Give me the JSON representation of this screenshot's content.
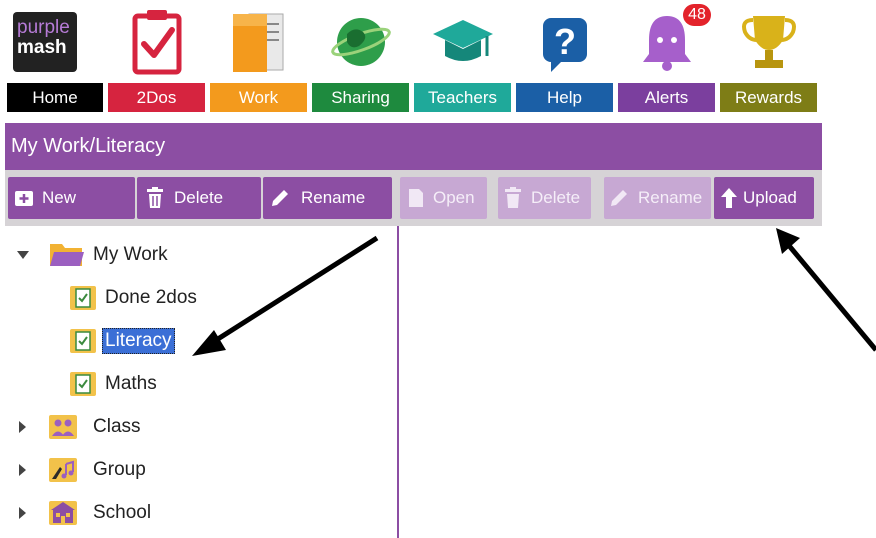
{
  "nav": {
    "items": [
      {
        "key": "home",
        "label": "Home",
        "color": "#000000",
        "icon": "purple-mash-logo",
        "logo_line1": "purple",
        "logo_line2": "mash"
      },
      {
        "key": "2dos",
        "label": "2Dos",
        "color": "#d6243f",
        "icon": "clipboard-check-icon"
      },
      {
        "key": "work",
        "label": "Work",
        "color": "#f39a1d",
        "icon": "folder-icon"
      },
      {
        "key": "sharing",
        "label": "Sharing",
        "color": "#1e8a3e",
        "icon": "globe-icon"
      },
      {
        "key": "teachers",
        "label": "Teachers",
        "color": "#1fa99a",
        "icon": "graduation-cap-icon"
      },
      {
        "key": "help",
        "label": "Help",
        "color": "#1b5fa6",
        "icon": "question-icon"
      },
      {
        "key": "alerts",
        "label": "Alerts",
        "color": "#7b3f9e",
        "icon": "bell-icon",
        "badge": "48"
      },
      {
        "key": "rewards",
        "label": "Rewards",
        "color": "#7e7d16",
        "icon": "trophy-icon"
      }
    ]
  },
  "header": {
    "title": "My Work/Literacy"
  },
  "left_toolbar": {
    "new_label": "New",
    "delete_label": "Delete",
    "rename_label": "Rename"
  },
  "right_toolbar": {
    "open_label": "Open",
    "delete_label": "Delete",
    "rename_label": "Rename",
    "upload_label": "Upload"
  },
  "tree": {
    "my_work": "My Work",
    "done_2dos": "Done 2dos",
    "literacy": "Literacy",
    "maths": "Maths",
    "class": "Class",
    "group": "Group",
    "school": "School"
  },
  "colors": {
    "accent": "#8c4ea3",
    "accent_disabled": "#c7a8d3",
    "selection": "#3b6fd6",
    "toolbar_bg": "#d6d3d6"
  }
}
